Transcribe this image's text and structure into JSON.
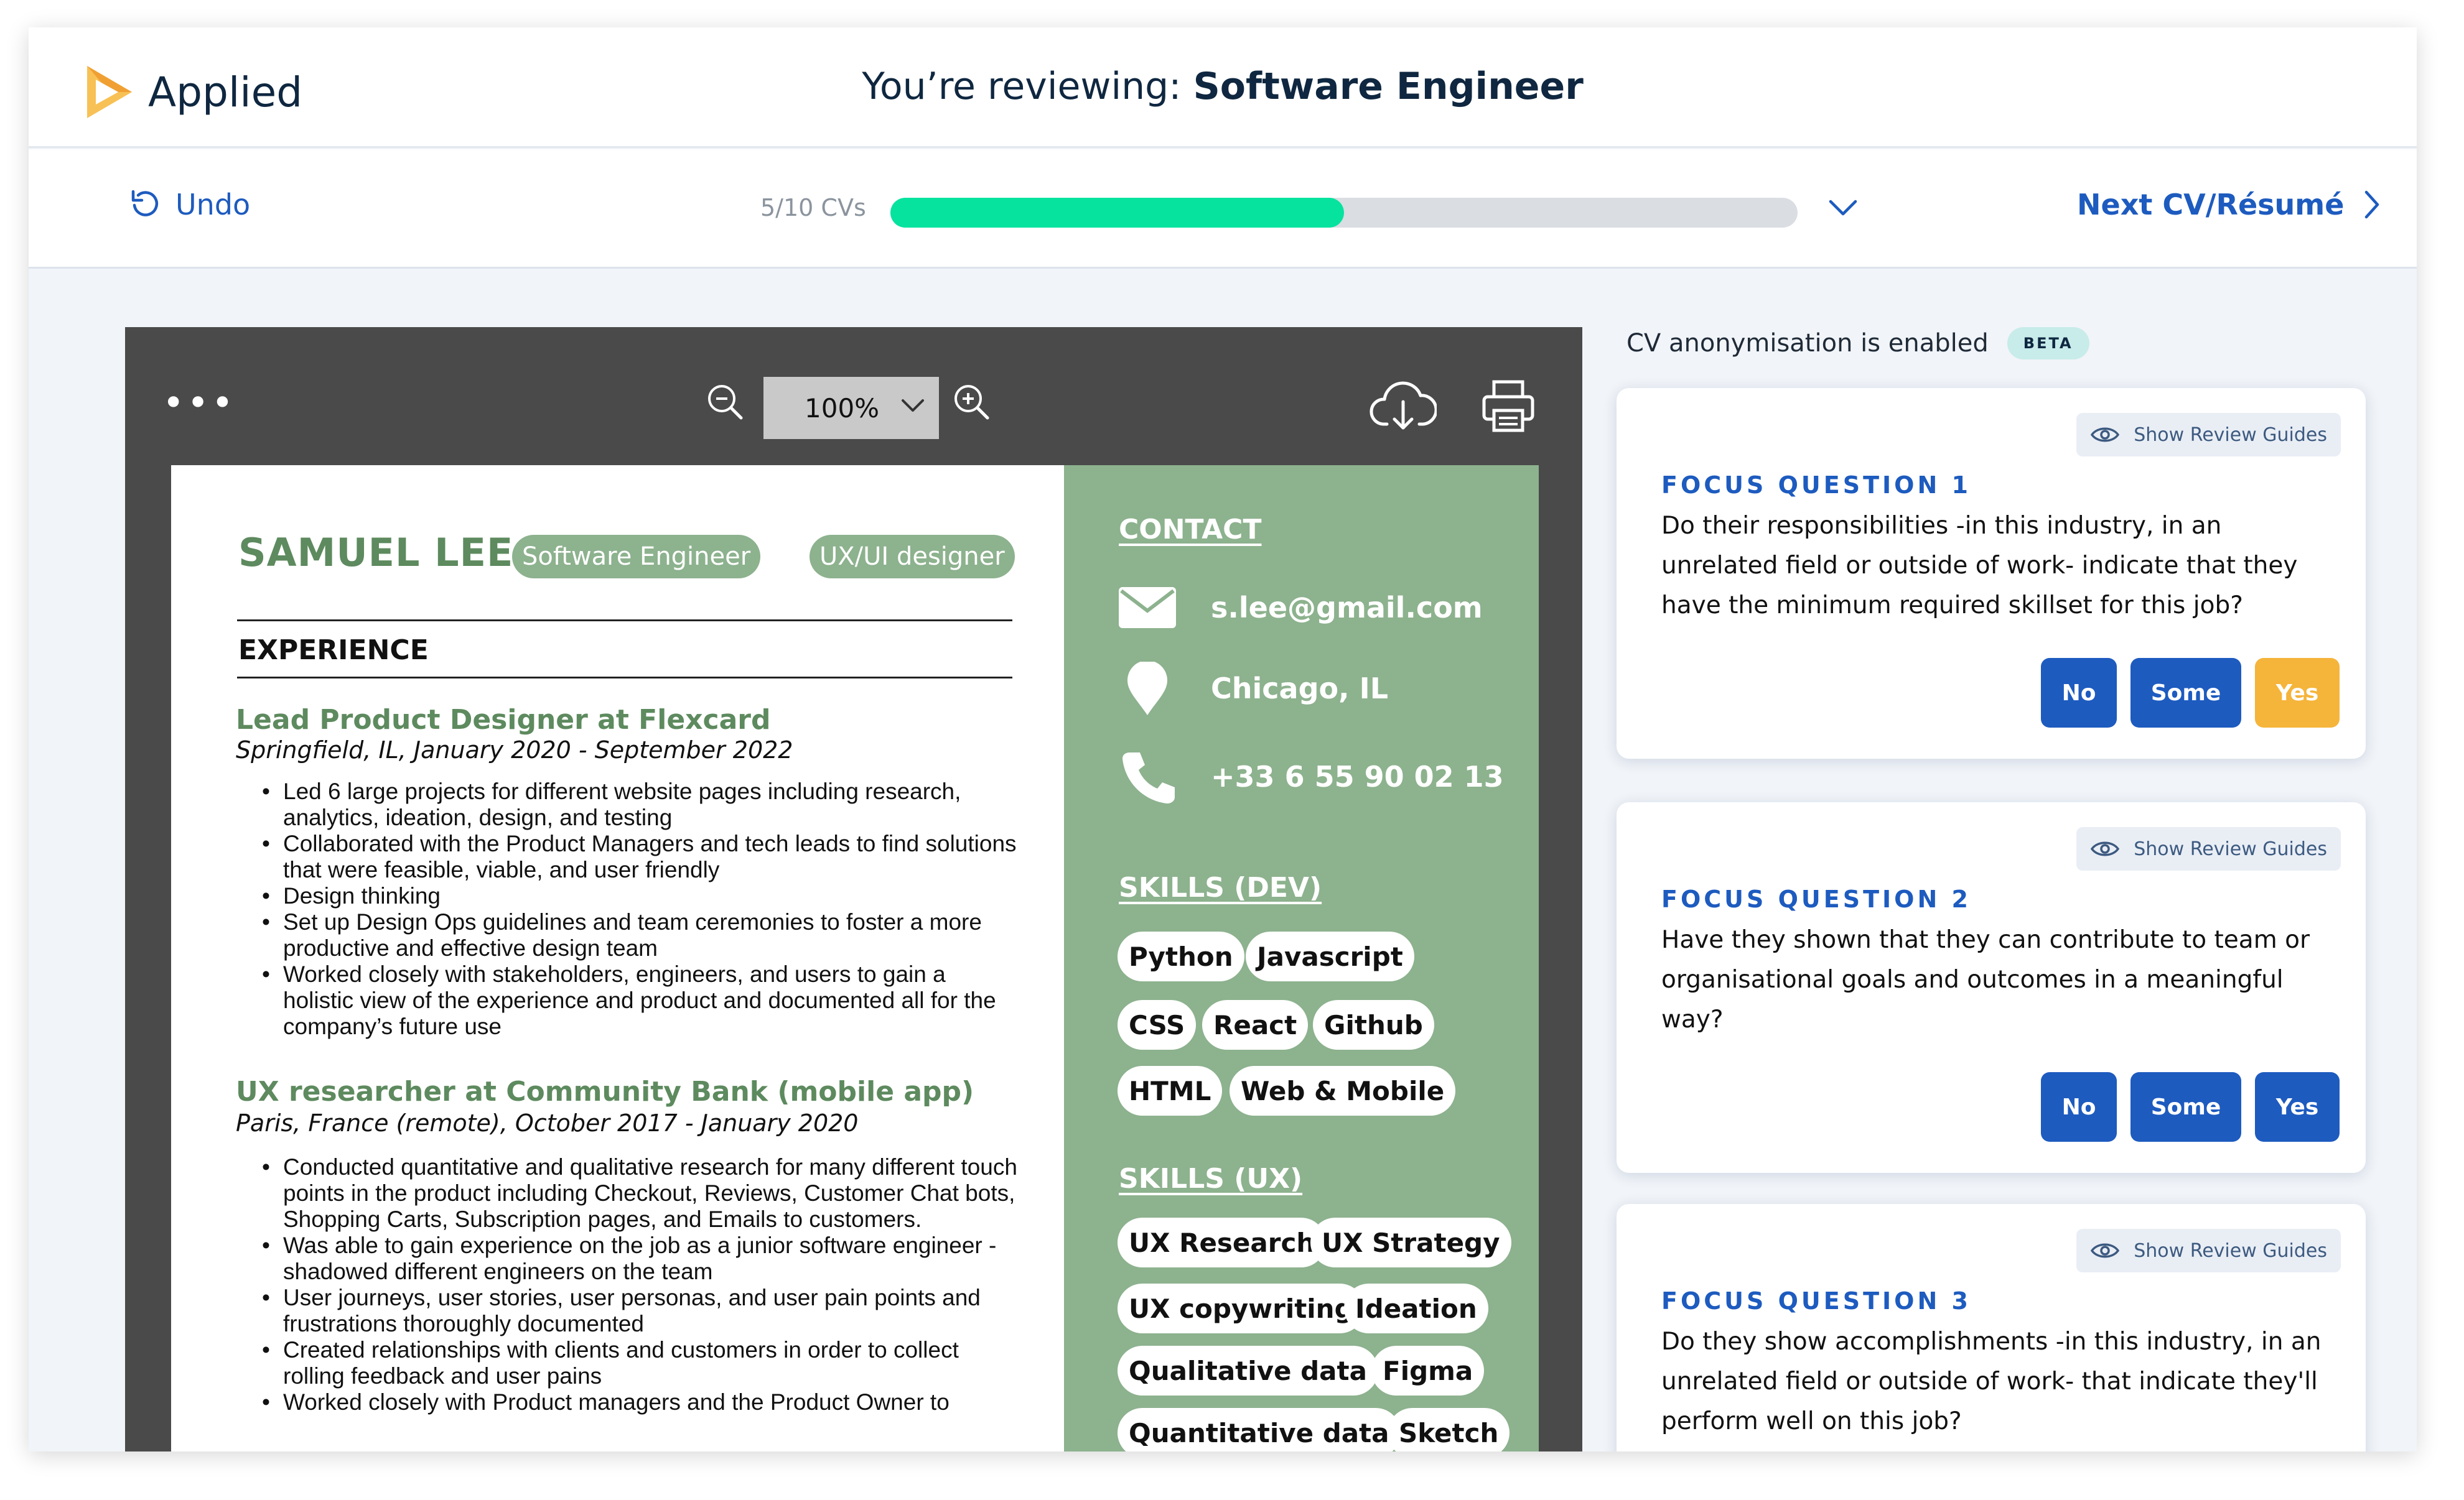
{
  "header": {
    "app_name": "Applied",
    "review_prefix": "You’re reviewing:",
    "review_role": "Software Engineer"
  },
  "toolbar": {
    "undo_label": "Undo",
    "cv_count": "5/10 CVs",
    "progress_fraction": 0.5,
    "next_label": "Next CV/Résumé"
  },
  "viewer": {
    "zoom": "100%",
    "icons": [
      "more-icon",
      "zoom-out-icon",
      "zoom-in-icon",
      "cloud-download-icon",
      "print-icon"
    ]
  },
  "cv": {
    "name": "SAMUEL LEE",
    "roles": [
      "Software Engineer",
      "UX/UI designer"
    ],
    "experience_heading": "EXPERIENCE",
    "jobs": [
      {
        "title": "Lead Product Designer at Flexcard",
        "meta": "Springfield, IL, January 2020 - September 2022",
        "bullets": [
          "Led 6 large projects for different website pages including research, analytics, ideation, design, and testing",
          "Collaborated with the Product Managers and tech leads to find solutions that were feasible, viable, and user friendly",
          "Design thinking",
          "Set up Design Ops guidelines and team ceremonies to foster a more productive and effective design team",
          "Worked closely with stakeholders, engineers, and users to gain a holistic view of the experience and product and documented all for the company’s future use"
        ]
      },
      {
        "title": "UX researcher at Community Bank (mobile app)",
        "meta": "Paris, France (remote), October 2017 - January 2020",
        "bullets": [
          "Conducted quantitative and qualitative research for many different touch points in the product including Checkout, Reviews, Customer Chat bots, Shopping Carts, Subscription pages, and Emails to customers.",
          "Was able to gain experience on the job as a junior software engineer - shadowed different engineers on the team",
          "User journeys, user stories, user personas, and user pain points and frustrations thoroughly documented",
          "Created relationships with clients and customers in order to collect rolling feedback and user pains",
          "Worked closely with Product managers and the Product Owner to"
        ]
      }
    ],
    "contact_heading": "CONTACT",
    "email": "s.lee@gmail.com",
    "location": "Chicago, IL",
    "phone": "+33 6 55 90 02 13",
    "skills_dev_heading": "SKILLS (DEV)",
    "skills_dev": [
      "Python",
      "Javascript",
      "CSS",
      "React",
      "Github",
      "HTML",
      "Web & Mobile"
    ],
    "skills_ux_heading": "SKILLS (UX)",
    "skills_ux": [
      "UX Research",
      "UX Strategy",
      "UX copywriting",
      "Ideation",
      "Qualitative data",
      "Figma",
      "Quantitative data",
      "Sketch"
    ]
  },
  "sidebar": {
    "anonymisation_text": "CV anonymisation is enabled",
    "beta_badge": "BETA",
    "guide_label": "Show Review Guides",
    "questions": [
      {
        "label": "FOCUS QUESTION 1",
        "text": "Do their responsibilities -in this industry, in an unrelated field or outside of work- indicate that they have the minimum required skillset for this job?",
        "answers": [
          "No",
          "Some",
          "Yes"
        ],
        "selected": "Yes"
      },
      {
        "label": "FOCUS QUESTION 2",
        "text": "Have they shown that they can contribute to team or organisational goals and outcomes in a meaningful way?",
        "answers": [
          "No",
          "Some",
          "Yes"
        ],
        "selected": ""
      },
      {
        "label": "FOCUS QUESTION 3",
        "text": "Do they show accomplishments -in this industry, in an unrelated field or outside of work- that indicate they'll perform well on this job?",
        "answers": [],
        "selected": ""
      }
    ]
  },
  "colors": {
    "brand_blue": "#1d5bbf",
    "progress_green": "#05e39f",
    "cv_green": "#8db28e",
    "selected_answer": "#f5b43a"
  }
}
